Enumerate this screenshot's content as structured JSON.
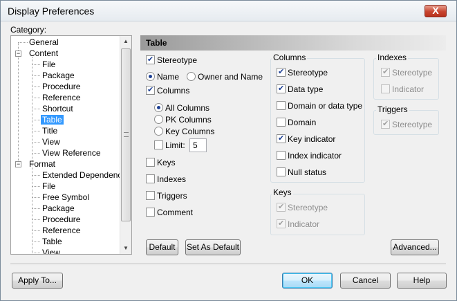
{
  "window": {
    "title": "Display Preferences",
    "close_label": "X"
  },
  "category": {
    "label": "Category:",
    "tree": [
      {
        "label": "General"
      },
      {
        "label": "Content",
        "expander": "−"
      },
      {
        "label": "File"
      },
      {
        "label": "Package"
      },
      {
        "label": "Procedure"
      },
      {
        "label": "Reference"
      },
      {
        "label": "Shortcut"
      },
      {
        "label": "Table",
        "selected": true
      },
      {
        "label": "Title"
      },
      {
        "label": "View"
      },
      {
        "label": "View Reference"
      },
      {
        "label": "Format",
        "expander": "−"
      },
      {
        "label": "Extended Dependency"
      },
      {
        "label": "File"
      },
      {
        "label": "Free Symbol"
      },
      {
        "label": "Package"
      },
      {
        "label": "Procedure"
      },
      {
        "label": "Reference"
      },
      {
        "label": "Table"
      },
      {
        "label": "View"
      }
    ],
    "scroll_up_icon": "arrow-up-icon",
    "scroll_down_icon": "arrow-down-icon"
  },
  "panel": {
    "header": "Table",
    "stereotype": {
      "label": "Stereotype",
      "checked": true
    },
    "name_radio": {
      "label": "Name",
      "checked": true
    },
    "owner_name_radio": {
      "label": "Owner and Name",
      "checked": false
    },
    "columns_check": {
      "label": "Columns",
      "checked": true
    },
    "all_columns": {
      "label": "All Columns",
      "checked": true
    },
    "pk_columns": {
      "label": "PK Columns",
      "checked": false
    },
    "key_columns": {
      "label": "Key Columns",
      "checked": false
    },
    "limit": {
      "label": "Limit:",
      "checked": false,
      "value": "5"
    },
    "keys": {
      "label": "Keys",
      "checked": false
    },
    "indexes": {
      "label": "Indexes",
      "checked": false
    },
    "triggers": {
      "label": "Triggers",
      "checked": false
    },
    "comment": {
      "label": "Comment",
      "checked": false
    }
  },
  "columns_group": {
    "title": "Columns",
    "items": [
      {
        "label": "Stereotype",
        "checked": true
      },
      {
        "label": "Data type",
        "checked": true
      },
      {
        "label": "Domain or data type",
        "checked": false
      },
      {
        "label": "Domain",
        "checked": false
      },
      {
        "label": "Key indicator",
        "checked": true
      },
      {
        "label": "Index indicator",
        "checked": false
      },
      {
        "label": "Null status",
        "checked": false
      }
    ]
  },
  "keys_group": {
    "title": "Keys",
    "items": [
      {
        "label": "Stereotype",
        "checked": true,
        "disabled": true
      },
      {
        "label": "Indicator",
        "checked": true,
        "disabled": true
      }
    ]
  },
  "indexes_group": {
    "title": "Indexes",
    "items": [
      {
        "label": "Stereotype",
        "checked": true,
        "disabled": true
      },
      {
        "label": "Indicator",
        "checked": false,
        "disabled": true
      }
    ]
  },
  "triggers_group": {
    "title": "Triggers",
    "items": [
      {
        "label": "Stereotype",
        "checked": true,
        "disabled": true
      }
    ]
  },
  "buttons": {
    "default": "Default",
    "set_as_default": "Set As Default",
    "advanced": "Advanced...",
    "apply_to": "Apply To...",
    "ok": "OK",
    "cancel": "Cancel",
    "help": "Help"
  }
}
